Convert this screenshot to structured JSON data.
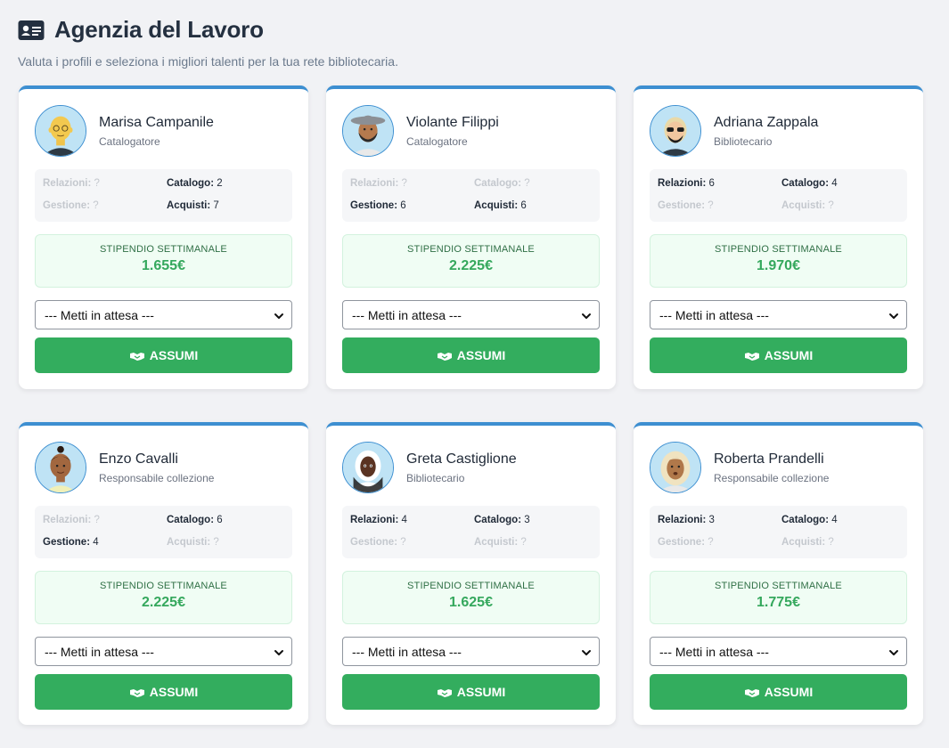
{
  "page": {
    "title": "Agenzia del Lavoro",
    "subtitle": "Valuta i profili e seleziona i migliori talenti per la tua rete bibliotecaria.",
    "title_icon": "id-card-icon"
  },
  "labels": {
    "relations": "Relazioni:",
    "catalog": "Catalogo:",
    "management": "Gestione:",
    "purchases": "Acquisti:",
    "salary": "STIPENDIO SETTIMANALE",
    "select_placeholder": "--- Metti in attesa ---",
    "hire": "ASSUMI"
  },
  "colors": {
    "accent": "#3d8fd1",
    "hire_button": "#33ad5e",
    "salary_text": "#35a85d"
  },
  "candidates": [
    {
      "name": "Marisa Campanile",
      "role": "Catalogatore",
      "relations": "?",
      "catalog": "2",
      "management": "?",
      "purchases": "7",
      "salary": "1.655€",
      "avatar_icon": "avatar-bald-glasses-icon"
    },
    {
      "name": "Violante Filippi",
      "role": "Catalogatore",
      "relations": "?",
      "catalog": "?",
      "management": "6",
      "purchases": "6",
      "salary": "2.225€",
      "avatar_icon": "avatar-hat-beard-icon"
    },
    {
      "name": "Adriana Zappala",
      "role": "Bibliotecario",
      "relations": "6",
      "catalog": "4",
      "management": "?",
      "purchases": "?",
      "salary": "1.970€",
      "avatar_icon": "avatar-sunglasses-icon"
    },
    {
      "name": "Enzo Cavalli",
      "role": "Responsabile collezione",
      "relations": "?",
      "catalog": "6",
      "management": "4",
      "purchases": "?",
      "salary": "2.225€",
      "avatar_icon": "avatar-bun-icon"
    },
    {
      "name": "Greta Castiglione",
      "role": "Bibliotecario",
      "relations": "4",
      "catalog": "3",
      "management": "?",
      "purchases": "?",
      "salary": "1.625€",
      "avatar_icon": "avatar-hijab-icon"
    },
    {
      "name": "Roberta Prandelli",
      "role": "Responsabile collezione",
      "relations": "3",
      "catalog": "4",
      "management": "?",
      "purchases": "?",
      "salary": "1.775€",
      "avatar_icon": "avatar-blonde-icon"
    }
  ]
}
